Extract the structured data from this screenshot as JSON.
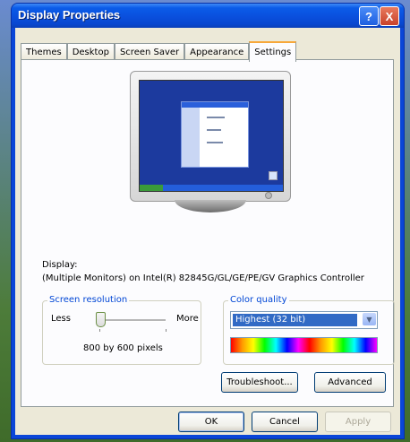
{
  "window": {
    "title": "Display Properties",
    "help_label": "?",
    "close_label": "X"
  },
  "tabs": [
    {
      "label": "Themes"
    },
    {
      "label": "Desktop"
    },
    {
      "label": "Screen Saver"
    },
    {
      "label": "Appearance"
    },
    {
      "label": "Settings",
      "active": true
    }
  ],
  "display": {
    "label": "Display:",
    "value": "(Multiple Monitors) on Intel(R) 82845G/GL/GE/PE/GV Graphics Controller"
  },
  "screen_resolution": {
    "group_label": "Screen resolution",
    "less_label": "Less",
    "more_label": "More",
    "value_text": "800 by 600 pixels",
    "slider_position": 0.0
  },
  "color_quality": {
    "group_label": "Color quality",
    "selected": "Highest (32 bit)"
  },
  "buttons": {
    "troubleshoot": "Troubleshoot...",
    "advanced": "Advanced",
    "ok": "OK",
    "cancel": "Cancel",
    "apply": "Apply"
  },
  "colors": {
    "titlebar": "#0a4fdd",
    "client_bg": "#ece9d8",
    "active_tab_accent": "#f7a83a",
    "group_label": "#0046d5",
    "selection": "#316ac5"
  }
}
